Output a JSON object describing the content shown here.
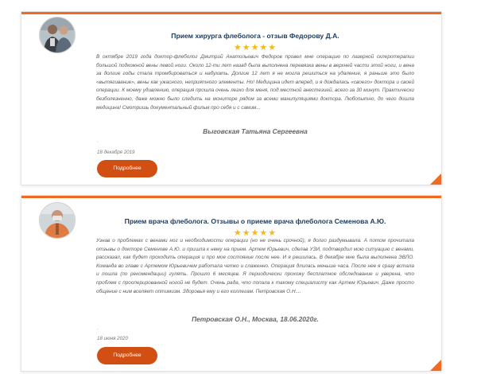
{
  "reviews": [
    {
      "title": "Прием хирурга флеболога - отзыв Федорову Д.А.",
      "stars": "★★★★★",
      "text": "В октябре 2019 года доктор-флеболог Дмитрий Анатольевич Федоров провел мне операцию по лазерной склеротерапии большой подкожной вены левой ноги. Около 12-ти лет назад была выполнена перевязка вены в верхней части этой ноги, и вена за долгие годы стала тромбироваться и набухать. Долгие 12 лет я не могла решиться на удаление, я раньше это было «вытягивание», вены как ужасного, неприятного элементы. Но! Медицина идет вперед, и я дождалась «своего» доктора и своей операции. К моему удивлению, операция прошла очень легко для меня, под местной анестезией, всего за 30 минут. Практически безболезненно, даже можно было следить на мониторе рядом за всеми манипуляциями доктора. Любопытно, до чего дошла медицина! Смотришь документальный фильм про себя и с самим...",
      "author": "Выговская Татьяна Сергеевна",
      "dot": ".",
      "date": "18 декабря 2019",
      "button": "Подробнее"
    },
    {
      "title": "Прием врача флеболога. Отзывы о приеме врача флеболога Семенова А.Ю.",
      "stars": "★★★★★",
      "text": "Узнав о проблемах с венами ног и необходимости операции (но не очень срочной), я долго раздумывала. А потом прочитала отзывы о докторе Семенове А.Ю. и пришла к нему на прием. Артем Юрьевич, сделав УЗИ, подтвердил мою ситуацию с венами, рассказал, как будет проходить операция и про мое состояние после нее. И я решилась. В декабре мне была выполнена ЭВЛО. Команда во главе с Артемом Юрьевичем работала четко и слаженно. Операция длилась меньше часа. После нее я сразу встала и пошла (по рекомендации) гулять. Прошло 6 месяцев. Я периодически прохожу бесплатное обследование и уверена, что проблем с прооперированной ногой не будет. Очень рада, что попала к такому специалисту как Артем Юрьевич. Даже просто общение с ним вселяет оптимизм. Здоровья ему и его коллегам. Петровская О.Н....",
      "author": "Петровская О.Н., Москва, 18.06.2020г.",
      "dot": ".",
      "date": "18 июня 2020",
      "button": "Подробнее"
    }
  ],
  "colors": {
    "accent": "#f06a22",
    "button": "#d14f13",
    "title": "#1d3d63",
    "stars": "#f6b91a"
  }
}
